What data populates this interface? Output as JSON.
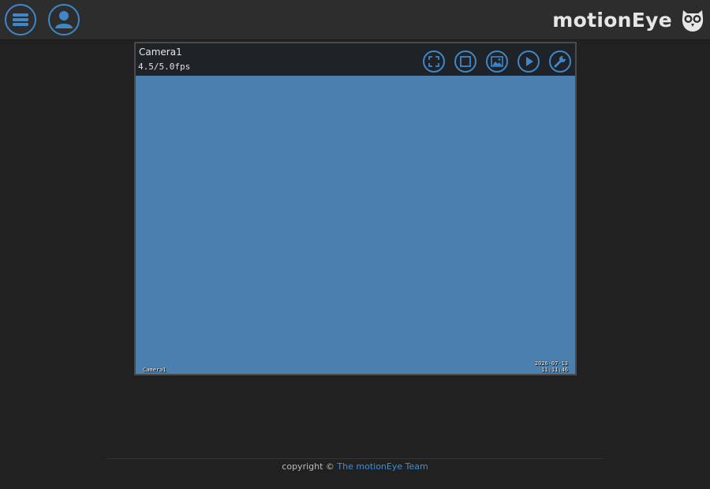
{
  "header": {
    "brand": "motionEye",
    "menu_icon": "menu-icon",
    "user_icon": "user-icon",
    "logo_icon": "owl-logo-icon"
  },
  "camera": {
    "name": "Camera1",
    "fps": "4.5/5.0fps",
    "overlay_left": "Camera1",
    "overlay_date": "2026-07-13",
    "overlay_time": "11:11:46",
    "buttons": [
      {
        "icon": "fullscreen-icon"
      },
      {
        "icon": "frame-icon"
      },
      {
        "icon": "pictures-icon"
      },
      {
        "icon": "play-icon"
      },
      {
        "icon": "wrench-icon"
      }
    ]
  },
  "footer": {
    "prefix": "copyright ©",
    "link": "The motionEye Team"
  },
  "colors": {
    "accent": "#3f87c9",
    "background": "#212121",
    "topbar": "#2d2d2d",
    "camera_view": "#4a7fae"
  }
}
